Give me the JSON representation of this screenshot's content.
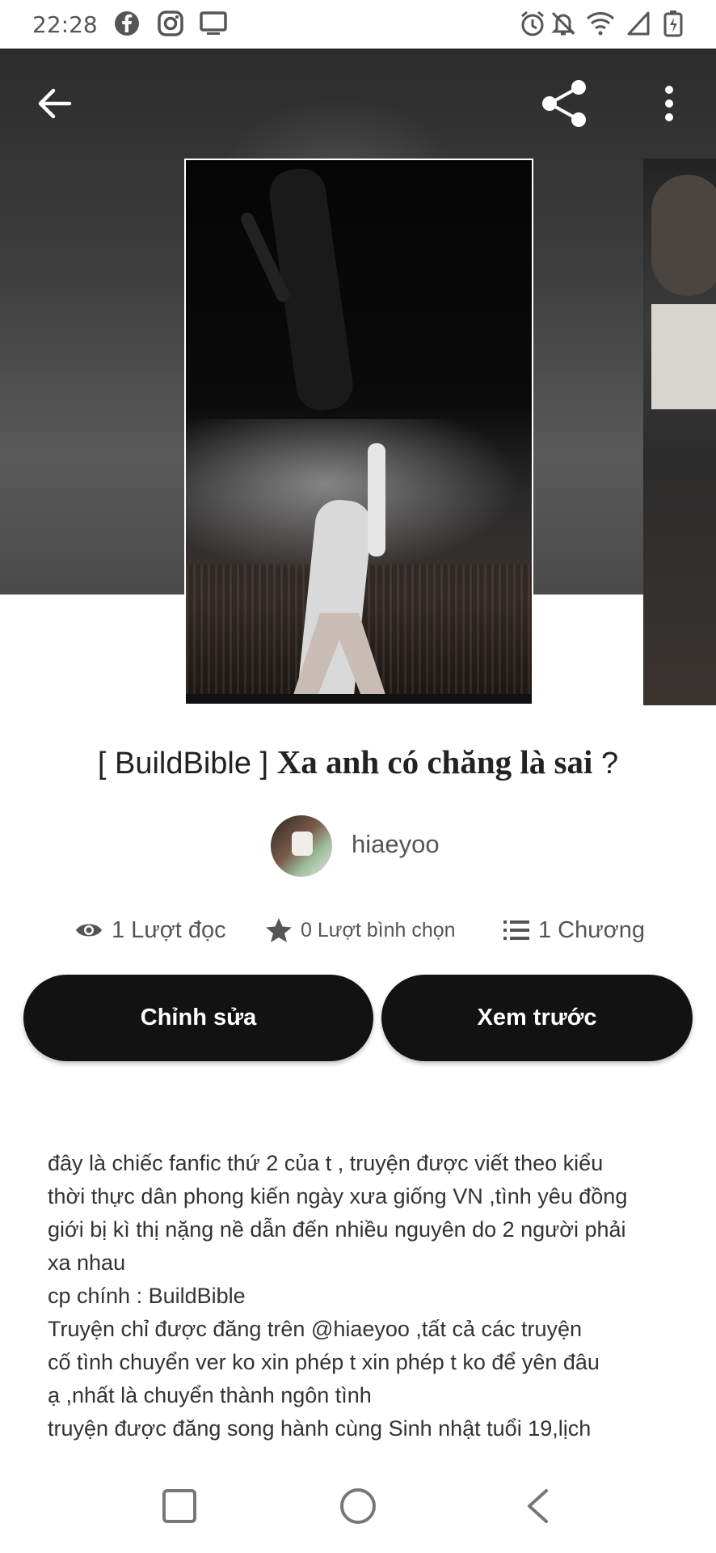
{
  "status_bar": {
    "time": "22:28",
    "left_icons": [
      "facebook-icon",
      "instagram-icon",
      "screen-icon"
    ],
    "right_icons": [
      "alarm-icon",
      "mute-icon",
      "wifi-icon",
      "signal-icon",
      "battery-icon"
    ]
  },
  "top_bar": {
    "back_icon": "arrow-left-icon",
    "share_icon": "share-icon",
    "menu_icon": "more-vertical-icon"
  },
  "story": {
    "title_tag": "[ BuildBible ]",
    "title_main": "Xa anh có chăng là sai",
    "title_end": "?",
    "author": "hiaeyoo",
    "stats": {
      "reads": "1 Lượt đọc",
      "votes": "0 Lượt bình chọn",
      "chapters": "1 Chương"
    },
    "buttons": {
      "edit": "Chỉnh sửa",
      "preview": "Xem trước"
    },
    "description": [
      "đây là chiếc fanfic thứ 2 của t , truyện được viết theo kiểu",
      "thời thực dân phong kiến ngày xưa giống VN ,tình yêu đồng",
      "giới bị kì thị nặng nề dẫn đến nhiều nguyên do 2 người phải",
      "xa nhau",
      "cp chính : BuildBible",
      "Truyện chỉ được đăng trên @hiaeyoo ,tất cả các truyện",
      "cố tình chuyển ver ko xin phép t xin phép t ko để yên đâu",
      "ạ ,nhất là chuyển thành ngôn tình",
      "truyện được đăng song hành cùng Sinh nhật tuổi 19,lịch"
    ]
  },
  "nav_bar": {
    "recents_icon": "square-icon",
    "home_icon": "circle-icon",
    "back_icon": "triangle-back-icon"
  },
  "colors": {
    "button_bg": "#121212",
    "hero_bg": "#3d3d3d",
    "text": "#333333"
  }
}
